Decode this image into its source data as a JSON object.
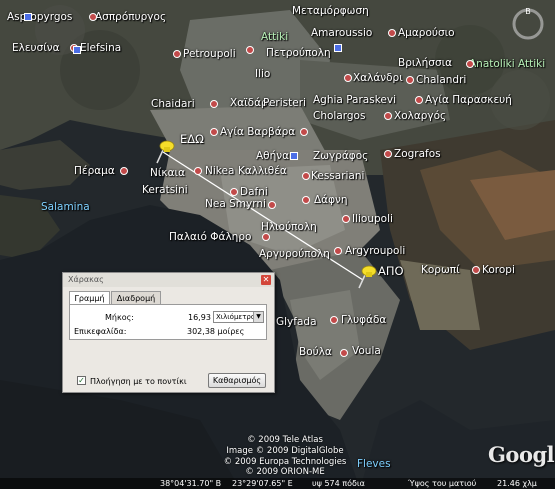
{
  "places": [
    {
      "label": "Aspropyrgos"
    },
    {
      "label": "Ασπρόπυργος"
    },
    {
      "label": "Μεταμόρφωση"
    },
    {
      "label": "Amaroussio"
    },
    {
      "label": "Αμαρούσιο"
    },
    {
      "label": "Ελευσίνα"
    },
    {
      "label": "Elefsina"
    },
    {
      "label": "Attiki"
    },
    {
      "label": "Πετρούπολη"
    },
    {
      "label": "Petroupoli"
    },
    {
      "label": "Ilio"
    },
    {
      "label": "Βριλήσσια"
    },
    {
      "label": "Χαλάνδρι"
    },
    {
      "label": "Chalandri"
    },
    {
      "label": "Anatoliki Attiki"
    },
    {
      "label": "Chaidari"
    },
    {
      "label": "Χαϊδάρι"
    },
    {
      "label": "Peristeri"
    },
    {
      "label": "Aghia Paraskevi"
    },
    {
      "label": "Αγία Παρασκευή"
    },
    {
      "label": "Cholargos"
    },
    {
      "label": "Χολαργός"
    },
    {
      "label": "ΕΔΩ"
    },
    {
      "label": "Αγία Βαρβάρα"
    },
    {
      "label": "Αθήνα"
    },
    {
      "label": "Ζωγράφος"
    },
    {
      "label": "Zografos"
    },
    {
      "label": "Πέραμα"
    },
    {
      "label": "Νίκαια"
    },
    {
      "label": "Nikea"
    },
    {
      "label": "Καλλιθέα"
    },
    {
      "label": "Kessariani"
    },
    {
      "label": "Keratsini"
    },
    {
      "label": "Dafni"
    },
    {
      "label": "Salamina"
    },
    {
      "label": "Nea Smyrni"
    },
    {
      "label": "Δάφνη"
    },
    {
      "label": "Ηλιούπολη"
    },
    {
      "label": "Ilioupoli"
    },
    {
      "label": "Παλαιό Φάληρο"
    },
    {
      "label": "Αργυρούπολη"
    },
    {
      "label": "Argyroupoli"
    },
    {
      "label": "ΑΠΟ"
    },
    {
      "label": "Κορωπί"
    },
    {
      "label": "Koropi"
    },
    {
      "label": "Glyfada"
    },
    {
      "label": "Γλυφάδα"
    },
    {
      "label": "Βούλα"
    },
    {
      "label": "Voula"
    },
    {
      "label": "Fleves"
    }
  ],
  "credits": [
    "© 2009 Tele Atlas",
    "Image © 2009 DigitalGlobe",
    "© 2009 Europa Technologies",
    "© 2009 ORION-ME"
  ],
  "statusbar": {
    "lat": "38°04'31.70\" Β",
    "lon": "23°29'07.65\" Ε",
    "elev": "υψ  574 πόδια",
    "eye_alt": "Ύψος του ματιού",
    "eye_time": "21.46 χλμ"
  },
  "logo": "Google",
  "ruler": {
    "title": "Χάρακας",
    "tabs": [
      "Γραμμή",
      "Διαδρομή"
    ],
    "length_label": "Μήκος:",
    "length_value": "16,93",
    "length_unit": "Χιλιόμετρα",
    "heading_label": "Επικεφαλίδα:",
    "heading_value": "302,38 μοίρες",
    "mouse_nav_label": "Πλοήγηση με το ποντίκι",
    "mouse_nav_checked": true,
    "clear_button": "Καθαρισμός"
  }
}
